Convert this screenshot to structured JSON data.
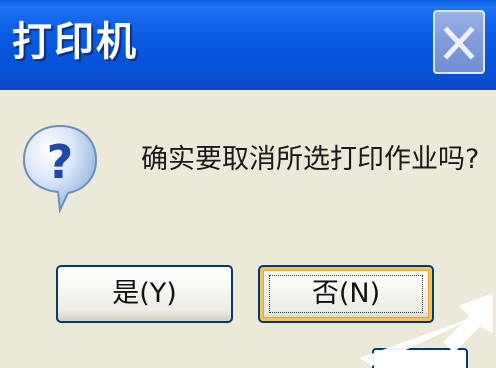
{
  "dialog": {
    "title": "打印机",
    "message": "确实要取消所选打印作业吗?",
    "icon": "question-icon",
    "buttons": {
      "yes_label": "是(Y)",
      "no_label": "否(N)"
    }
  },
  "colors": {
    "titlebar": "#0a5fe0",
    "dialog_bg": "#ece9d8",
    "button_border": "#003c74",
    "focus_highlight": "#f6c35b"
  }
}
